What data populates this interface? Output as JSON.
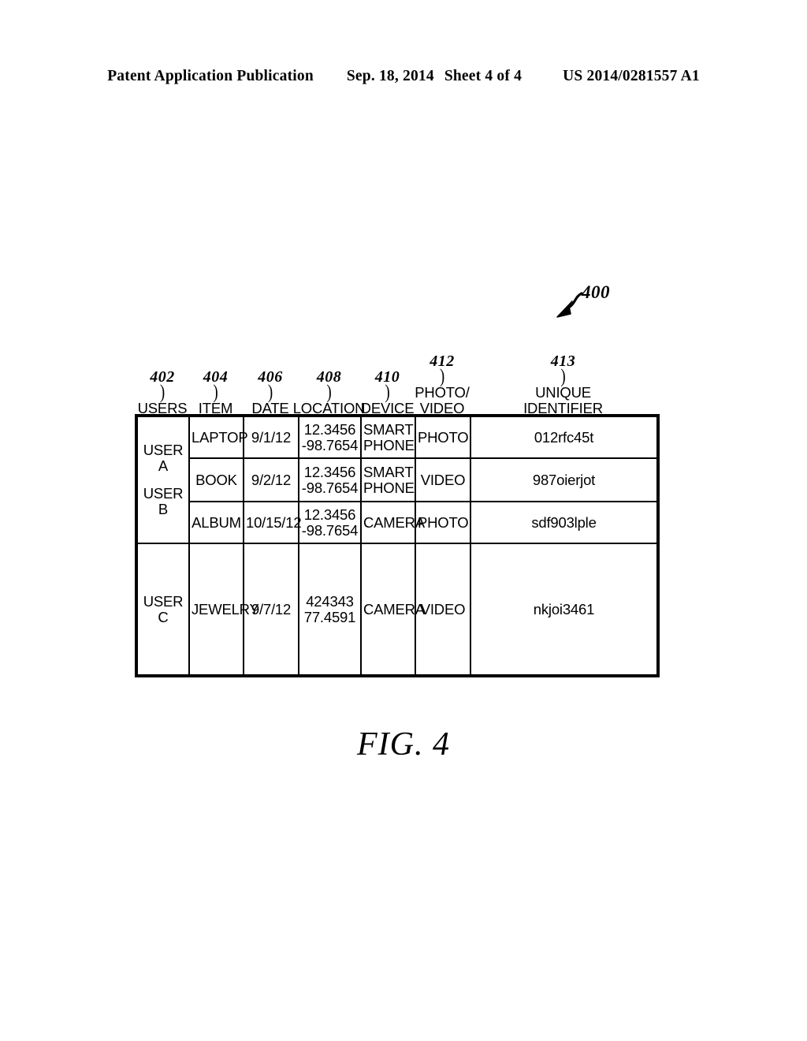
{
  "header": {
    "publication": "Patent Application Publication",
    "date": "Sep. 18, 2014",
    "sheet": "Sheet 4 of 4",
    "patent_number": "US 2014/0281557 A1"
  },
  "figure": {
    "caption": "FIG. 4",
    "callout": "400",
    "leader_mark": ")"
  },
  "columns": [
    {
      "ref": "402",
      "label_line1": "USERS",
      "label_line2": ""
    },
    {
      "ref": "404",
      "label_line1": "ITEM",
      "label_line2": ""
    },
    {
      "ref": "406",
      "label_line1": "DATE",
      "label_line2": ""
    },
    {
      "ref": "408",
      "label_line1": "LOCATION",
      "label_line2": ""
    },
    {
      "ref": "410",
      "label_line1": "DEVICE",
      "label_line2": ""
    },
    {
      "ref": "412",
      "label_line1": "PHOTO/",
      "label_line2": "VIDEO"
    },
    {
      "ref": "413",
      "label_line1": "UNIQUE",
      "label_line2": "IDENTIFIER"
    }
  ],
  "table": {
    "users_group_1": {
      "line1": "USER A",
      "line2": "USER B"
    },
    "users_group_2": "USER C",
    "rows": [
      {
        "item": "LAPTOP",
        "date": "9/1/12",
        "location_line1": "12.3456",
        "location_line2": "-98.7654",
        "device_line1": "SMART",
        "device_line2": "PHONE",
        "photo_video": "PHOTO",
        "unique_identifier": "012rfc45t"
      },
      {
        "item": "BOOK",
        "date": "9/2/12",
        "location_line1": "12.3456",
        "location_line2": "-98.7654",
        "device_line1": "SMART",
        "device_line2": "PHONE",
        "photo_video": "VIDEO",
        "unique_identifier": "987oierjot"
      },
      {
        "item": "ALBUM",
        "date": "10/15/12",
        "location_line1": "12.3456",
        "location_line2": "-98.7654",
        "device_line1": "CAMERA",
        "device_line2": "",
        "photo_video": "PHOTO",
        "unique_identifier": "sdf903lple"
      },
      {
        "item": "JEWELRY",
        "date": "9/7/12",
        "location_line1": "424343",
        "location_line2": "77.4591",
        "device_line1": "CAMERA",
        "device_line2": "",
        "photo_video": "VIDEO",
        "unique_identifier": "nkjoi3461"
      }
    ]
  },
  "colors": {
    "ink": "#000000",
    "paper": "#ffffff"
  }
}
